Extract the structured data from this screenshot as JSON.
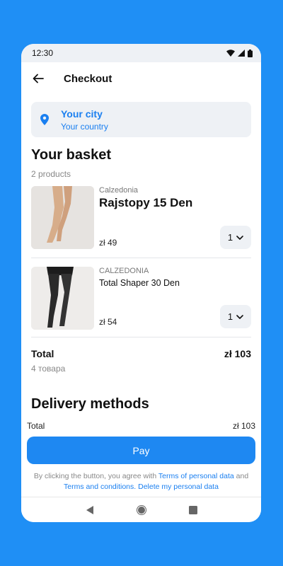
{
  "status_bar": {
    "time": "12:30",
    "icons": [
      "wifi-icon",
      "signal-icon",
      "battery-icon"
    ]
  },
  "app_bar": {
    "title": "Checkout"
  },
  "location": {
    "city": "Your city",
    "country": "Your country"
  },
  "basket": {
    "title": "Your basket",
    "count": "2 products",
    "items": [
      {
        "brand": "Calzedonia",
        "name": "Rajstopy 15 Den",
        "price": "zł 49",
        "quantity": "1"
      },
      {
        "brand": "CALZEDONIA",
        "name": "Total Shaper 30 Den",
        "price": "zł 54",
        "quantity": "1"
      }
    ],
    "total_label": "Total",
    "total_value": "zł 103",
    "total_sub": "4 товара"
  },
  "delivery": {
    "title": "Delivery methods"
  },
  "footer": {
    "total_label": "Total",
    "total_value": "zł 103",
    "pay_label": "Pay",
    "legal_prefix": "By clicking the button, you agree with ",
    "terms_personal": "Terms of personal data",
    "legal_and": " and ",
    "terms_conditions": "Terms and conditions.",
    "delete_data": "Delete my personal data"
  },
  "colors": {
    "background": "#1f8ff5",
    "accent": "#1e88f2",
    "card": "#eef1f5"
  }
}
